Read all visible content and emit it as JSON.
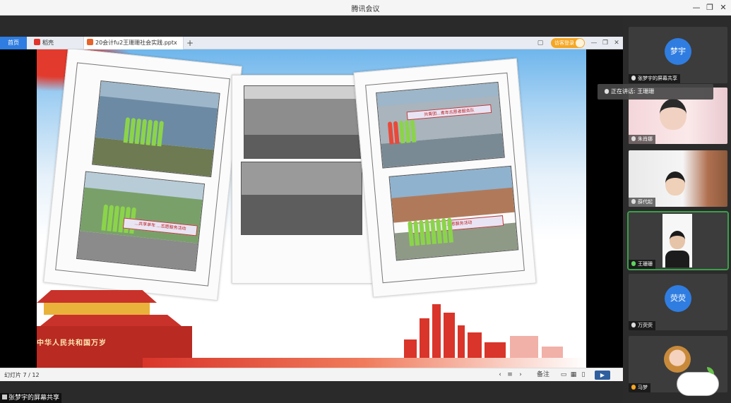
{
  "window": {
    "title": "腾讯会议",
    "controls": [
      "—",
      "❐",
      "✕"
    ]
  },
  "wps": {
    "tabs": [
      {
        "label": "首页"
      },
      {
        "label": "稻壳",
        "icon_color": "#e2332a"
      },
      {
        "label": "20会计fu2王珊珊社会实践.pptx",
        "icon_color": "#e8622b"
      }
    ],
    "new_tab": "+",
    "visitor_login": "访客登录",
    "status": {
      "page": "幻灯片 7 / 12",
      "notes": "备注",
      "play": "▶"
    }
  },
  "slide": {
    "banner1": "...共享单车 ...志愿服务活动",
    "banner2": "共青团...青年志愿者服务队",
    "banner3": "...志愿服务活动",
    "plaque": "中华人民共和国万岁"
  },
  "share_label": "张梦宇的屏幕共享",
  "speaking": "正在讲话: 王珊珊",
  "participants": [
    {
      "name": "张梦宇的屏幕共享",
      "avatar_text": "梦宇",
      "type": "avatar",
      "color": "#2f7de1"
    },
    {
      "name": "朱肖娜",
      "type": "video"
    },
    {
      "name": "薛代起",
      "type": "video"
    },
    {
      "name": "王珊珊",
      "type": "video",
      "active": true
    },
    {
      "name": "万荧荧",
      "avatar_text": "荧荧",
      "type": "avatar",
      "color": "#2f7de1"
    },
    {
      "name": "马梦",
      "type": "photo"
    }
  ]
}
